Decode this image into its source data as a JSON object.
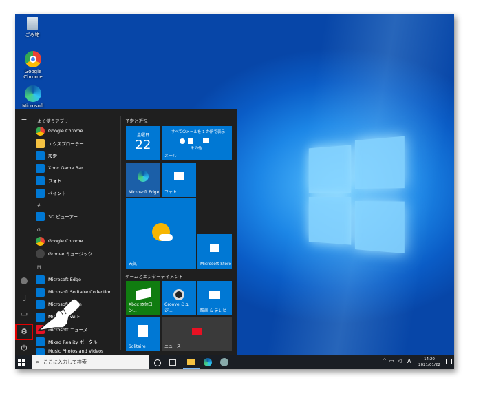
{
  "desktop": {
    "icons": [
      {
        "label": "ごみ箱",
        "icon": "recycle-bin-icon"
      },
      {
        "label": "Google Chrome",
        "icon": "chrome-icon"
      },
      {
        "label": "Microsoft Edge",
        "icon": "edge-icon"
      }
    ]
  },
  "start": {
    "frequent_header": "よく使うアプリ",
    "frequent": [
      {
        "label": "Google Chrome",
        "icon": "chrome-icon",
        "color": "#ffffff"
      },
      {
        "label": "エクスプローラー",
        "icon": "folder-icon",
        "color": "#f5c242"
      },
      {
        "label": "設定",
        "icon": "gear-icon",
        "color": "#0078d4"
      },
      {
        "label": "Xbox Game Bar",
        "icon": "xbox-icon",
        "color": "#107c10"
      },
      {
        "label": "フォト",
        "icon": "photos-icon",
        "color": "#0078d4"
      },
      {
        "label": "ペイント",
        "icon": "paint-icon",
        "color": "#0078d4"
      }
    ],
    "groups": [
      {
        "letter": "#",
        "apps": [
          {
            "label": "3D ビューアー",
            "icon": "cube-icon",
            "color": "#0078d4"
          }
        ]
      },
      {
        "letter": "G",
        "apps": [
          {
            "label": "Google Chrome",
            "icon": "chrome-icon",
            "color": "#ffffff"
          },
          {
            "label": "Groove ミュージック",
            "icon": "groove-icon",
            "color": "#333333"
          }
        ]
      },
      {
        "letter": "M",
        "apps": [
          {
            "label": "Microsoft Edge",
            "icon": "edge-icon",
            "color": "#0078d4"
          },
          {
            "label": "Microsoft Solitaire Collection",
            "icon": "cards-icon",
            "color": "#0078d4"
          },
          {
            "label": "Microsoft Store",
            "icon": "store-icon",
            "color": "#0078d4"
          },
          {
            "label": "Microsoft Wi-Fi",
            "icon": "wifi-icon",
            "color": "#0078d4"
          },
          {
            "label": "Microsoft ニュース",
            "icon": "news-icon",
            "color": "#e81123"
          },
          {
            "label": "Mixed Reality ポータル",
            "icon": "mr-icon",
            "color": "#0078d4"
          },
          {
            "label": "Music Photos and Videos",
            "icon": "media-icon",
            "color": "#0078d4"
          }
        ]
      }
    ],
    "tiles_header_1": "予定と近況",
    "tiles_header_2": "ゲームとエンターテイメント",
    "calendar": {
      "weekday": "金曜日",
      "day": "22"
    },
    "mail": {
      "text": "すべてのメールを 1 か所で表示",
      "more": "その他...",
      "label": "メール"
    },
    "tiles": {
      "edge": "Microsoft Edge",
      "photos": "フォト",
      "weather": "天気",
      "store": "Microsoft Store",
      "xbox": "Xbox 本体コン...",
      "groove": "Groove ミュージ...",
      "movies": "映画 & テレビ",
      "solitaire": "Solitaire",
      "news": "ニュース"
    }
  },
  "taskbar": {
    "search_placeholder": "ここに入力して検索",
    "time": "14:20",
    "date": "2021/01/22",
    "ime": "A"
  },
  "colors": {
    "highlight": "#e00000",
    "tile_blue": "#0078d4",
    "xbox_green": "#107c10"
  }
}
